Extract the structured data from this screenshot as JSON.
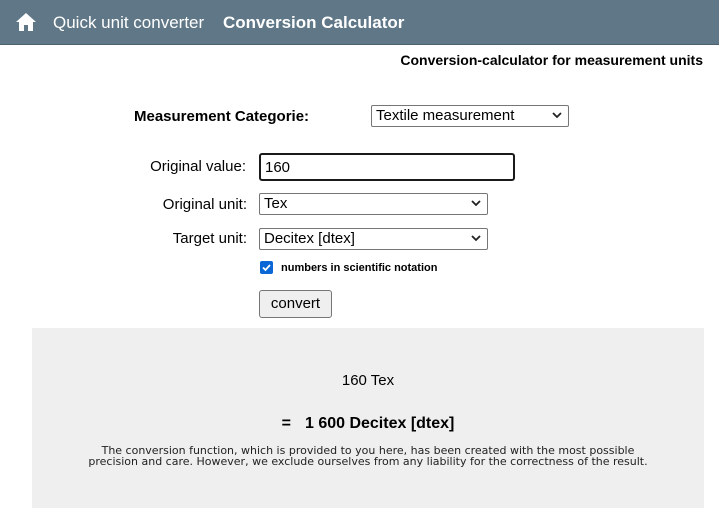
{
  "nav": {
    "home_icon": "home-icon",
    "quick_link": "Quick unit converter",
    "calc_link": "Conversion Calculator"
  },
  "subtitle": "Conversion-calculator for measurement units",
  "form": {
    "category_label": "Measurement Categorie:",
    "category_selected": "Textile measurement",
    "value_label": "Original value:",
    "value": "160",
    "orig_unit_label": "Original unit:",
    "orig_unit_selected": "Tex",
    "target_unit_label": "Target unit:",
    "target_unit_selected": "Decitex [dtex]",
    "scientific_checked": true,
    "scientific_label": "numbers in scientific notation",
    "convert_label": "convert"
  },
  "result": {
    "input_echo": "160 Tex",
    "equals": "=",
    "output": "1 600 Decitex [dtex]",
    "disclaimer": "The conversion function, which is provided to you here, has been created with the most possible precision and care. However, we exclude ourselves from any liability for the correctness of the result."
  },
  "colors": {
    "topbar": "#5f7786",
    "checkbox_accent": "#0b66d6",
    "result_panel": "#efefef"
  }
}
